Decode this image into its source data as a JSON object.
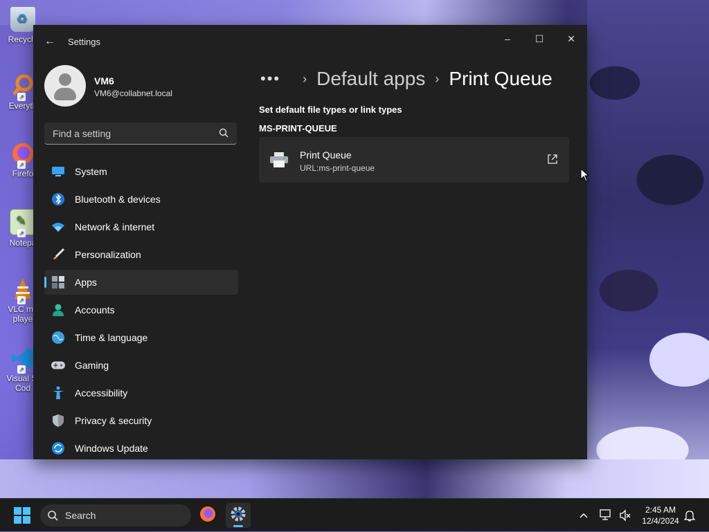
{
  "desktop": {
    "icons": [
      {
        "label": "Recycle"
      },
      {
        "label": "Everyth"
      },
      {
        "label": "Firefo"
      },
      {
        "label": "Notepa"
      },
      {
        "label": "VLC me\nplaye"
      },
      {
        "label": "Visual St\nCod"
      }
    ]
  },
  "window": {
    "title": "Settings",
    "controls": {
      "minimize": "–",
      "maximize": "☐",
      "close": "✕"
    }
  },
  "profile": {
    "name": "VM6",
    "email": "VM6@collabnet.local"
  },
  "search": {
    "placeholder": "Find a setting"
  },
  "nav": {
    "items": [
      {
        "label": "System",
        "icon": "monitor-icon"
      },
      {
        "label": "Bluetooth & devices",
        "icon": "bluetooth-icon"
      },
      {
        "label": "Network & internet",
        "icon": "wifi-icon"
      },
      {
        "label": "Personalization",
        "icon": "brush-icon"
      },
      {
        "label": "Apps",
        "icon": "apps-icon",
        "selected": true
      },
      {
        "label": "Accounts",
        "icon": "person-icon"
      },
      {
        "label": "Time & language",
        "icon": "globe-clock-icon"
      },
      {
        "label": "Gaming",
        "icon": "gamepad-icon"
      },
      {
        "label": "Accessibility",
        "icon": "accessibility-icon"
      },
      {
        "label": "Privacy & security",
        "icon": "shield-icon"
      },
      {
        "label": "Windows Update",
        "icon": "update-icon"
      }
    ]
  },
  "breadcrumb": {
    "more": "•••",
    "items": [
      "Default apps",
      "Print Queue"
    ]
  },
  "main": {
    "section_heading": "Set default file types or link types",
    "type_heading": "MS-PRINT-QUEUE",
    "app_card": {
      "name": "Print Queue",
      "subtitle": "URL:ms-print-queue"
    }
  },
  "taskbar": {
    "search_label": "Search",
    "time": "2:45 AM",
    "date": "12/4/2024"
  },
  "colors": {
    "accent": "#4cc2ff",
    "window_bg": "#202020",
    "card_bg": "#2b2b2b"
  }
}
